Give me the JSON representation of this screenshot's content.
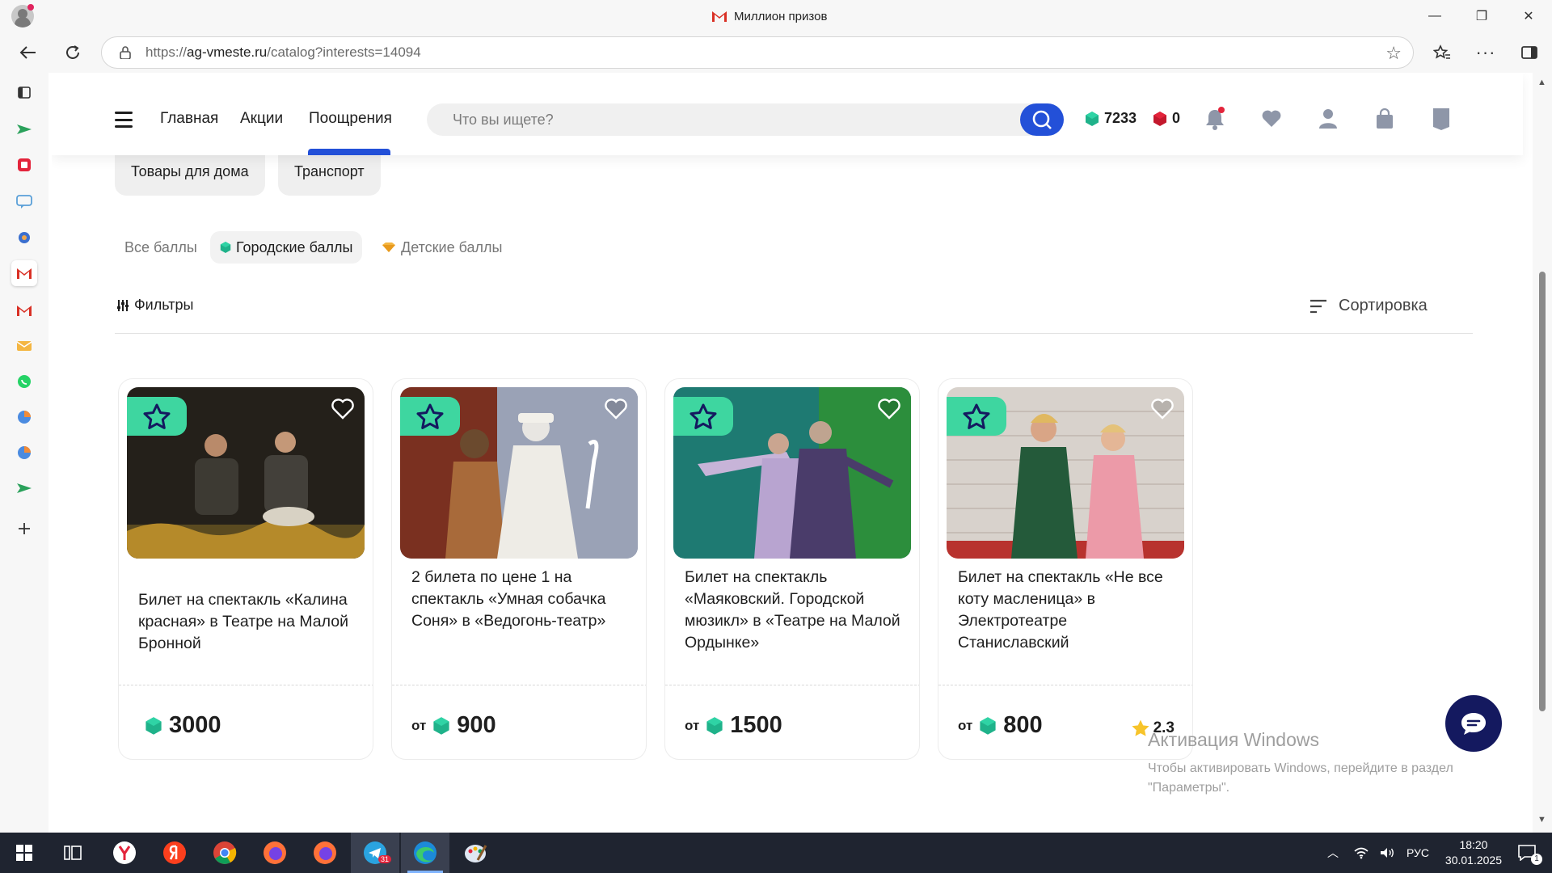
{
  "window": {
    "title": "Миллион призов",
    "controls": [
      "—",
      "❐",
      "✕"
    ]
  },
  "browser": {
    "url_prefix": "https://",
    "url_domain": "ag-vmeste.ru",
    "url_path": "/catalog?interests=14094"
  },
  "header": {
    "menu": [
      {
        "label": "Главная"
      },
      {
        "label": "Акции"
      },
      {
        "label": "Поощрения"
      }
    ],
    "active_menu": "Поощрения",
    "search_placeholder": "Что вы ищете?",
    "city_points": "7233",
    "kids_points": "0",
    "icons": [
      "bell-icon",
      "heart-icon",
      "user-icon",
      "bag-icon",
      "bookmark-icon"
    ]
  },
  "categories": [
    {
      "label": "Товары для дома"
    },
    {
      "label": "Транспорт"
    }
  ],
  "point_tabs": [
    {
      "label": "Все баллы"
    },
    {
      "label": "Городские баллы"
    },
    {
      "label": "Детские баллы"
    }
  ],
  "active_point_tab": "Городские баллы",
  "filters_label": "Фильтры",
  "sort_label": "Сортировка",
  "cards": [
    {
      "title": "Билет на спектакль «Калина красная» в Театре на Малой Бронной",
      "prefix": "",
      "price": "3000",
      "rating": ""
    },
    {
      "title": "2 билета по цене 1 на спектакль «Умная собачка Соня» в «Ведогонь-театр»",
      "prefix": "от",
      "price": "900",
      "rating": ""
    },
    {
      "title": "Билет на спектакль «Маяковский. Городской мюзикл» в «Театре на Малой Ордынке»",
      "prefix": "от",
      "price": "1500",
      "rating": ""
    },
    {
      "title": "Билет на спектакль «Не все коту масленица» в Электротеатре Станиславский",
      "prefix": "от",
      "price": "800",
      "rating": "2.3"
    }
  ],
  "watermark": {
    "title": "Активация Windows",
    "line1": "Чтобы активировать Windows, перейдите в раздел",
    "line2": "\"Параметры\"."
  },
  "taskbar": {
    "language": "РУС",
    "time": "18:20",
    "date": "30.01.2025",
    "notification_count": "1",
    "telegram_badge": "31"
  },
  "colors": {
    "accent_blue": "#2350d8",
    "city_points_green": "#1fb28a",
    "kids_points_red": "#e3243b",
    "badge_green": "#3ed6a0",
    "chat_navy": "#14195f"
  }
}
